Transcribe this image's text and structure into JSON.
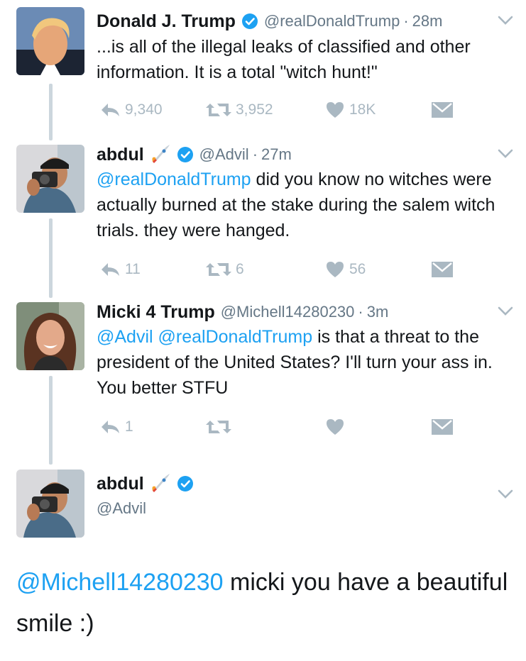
{
  "tweets": [
    {
      "name": "Donald J. Trump",
      "handle": "@realDonaldTrump",
      "time": "28m",
      "text": [
        {
          "t": "...is all of the illegal leaks of classified and other information. It is a total \"witch hunt!\"",
          "m": false
        }
      ],
      "reply_count": "9,340",
      "retweet_count": "3,952",
      "like_count": "18K"
    },
    {
      "name": "abdul",
      "handle": "@Advil",
      "time": "27m",
      "text": [
        {
          "t": "@realDonaldTrump",
          "m": true
        },
        {
          "t": " did you know no witches were actually burned at the stake during the salem witch trials. they were hanged.",
          "m": false
        }
      ],
      "reply_count": "11",
      "retweet_count": "6",
      "like_count": "56"
    },
    {
      "name": "Micki 4 Trump",
      "handle": "@Michell14280230",
      "time": "3m",
      "text": [
        {
          "t": "@Advil",
          "m": true
        },
        {
          "t": " ",
          "m": false
        },
        {
          "t": "@realDonaldTrump",
          "m": true
        },
        {
          "t": " is that a threat to the president of the United States? I'll turn your ass in. You better STFU",
          "m": false
        }
      ],
      "reply_count": "1",
      "retweet_count": "",
      "like_count": ""
    }
  ],
  "focused_tweet": {
    "name": "abdul",
    "handle": "@Advil",
    "text": [
      {
        "t": "@Michell14280230",
        "m": true
      },
      {
        "t": " micki you have a beautiful smile :)",
        "m": false
      }
    ]
  },
  "colors": {
    "link": "#1da1f2",
    "verified": "#1da1f2",
    "action_icon": "#aab8c2",
    "handle": "#657786",
    "thread_line": "#ccd6dd"
  },
  "icons": {
    "reply": "reply-icon",
    "retweet": "retweet-icon",
    "like": "heart-icon",
    "dm": "envelope-icon",
    "verified": "verified-badge-icon",
    "more": "chevron-down-icon",
    "emoji": "rocket-emoji-icon"
  }
}
